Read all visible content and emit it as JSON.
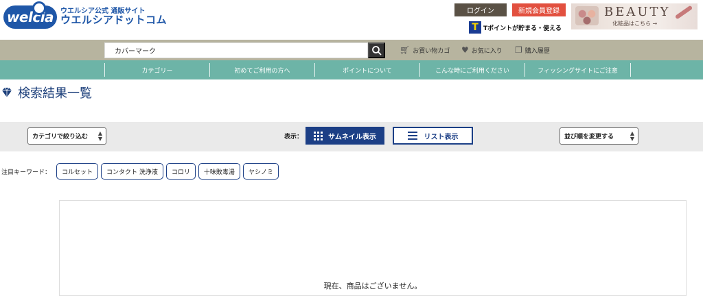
{
  "header": {
    "logo_text": "welcia",
    "logo_sub": "ウエルシア公式 通販サイト",
    "logo_main": "ウエルシアドットコム",
    "login_label": "ログイン",
    "register_label": "新規会員登録",
    "tpoint_mark": "T",
    "tpoint_text": "Tポイントが貯まる・使える",
    "beauty_title": "BEAUTY",
    "beauty_sub": "化粧品はこちら →"
  },
  "search": {
    "value": "カバーマーク",
    "cart_label": "お買い物カゴ",
    "favorites_label": "お気に入り",
    "history_label": "購入履歴"
  },
  "nav": {
    "items": [
      "カテゴリー",
      "初めてご利用の方へ",
      "ポイントについて",
      "こんな時にご利用ください",
      "フィッシングサイトにご注意"
    ]
  },
  "page": {
    "title": "検索結果一覧"
  },
  "toolbar": {
    "category_filter": "カテゴリで絞り込む",
    "view_label": "表示：",
    "thumbnail_view": "サムネイル表示",
    "list_view": "リスト表示",
    "sort_label": "並び順を変更する"
  },
  "keywords": {
    "label": "注目キーワード：",
    "items": [
      "コルセット",
      "コンタクト 洗浄液",
      "コロリ",
      "十味敗毒湯",
      "ヤシノミ"
    ]
  },
  "results": {
    "empty_message": "現在、商品はございません。"
  },
  "colors": {
    "brand_blue": "#1f57a8",
    "nav_teal": "#6db4a7",
    "search_bar": "#b7b49f",
    "register_red": "#e2503f",
    "login_brown": "#5a5145",
    "view_navy": "#1c3f86"
  }
}
